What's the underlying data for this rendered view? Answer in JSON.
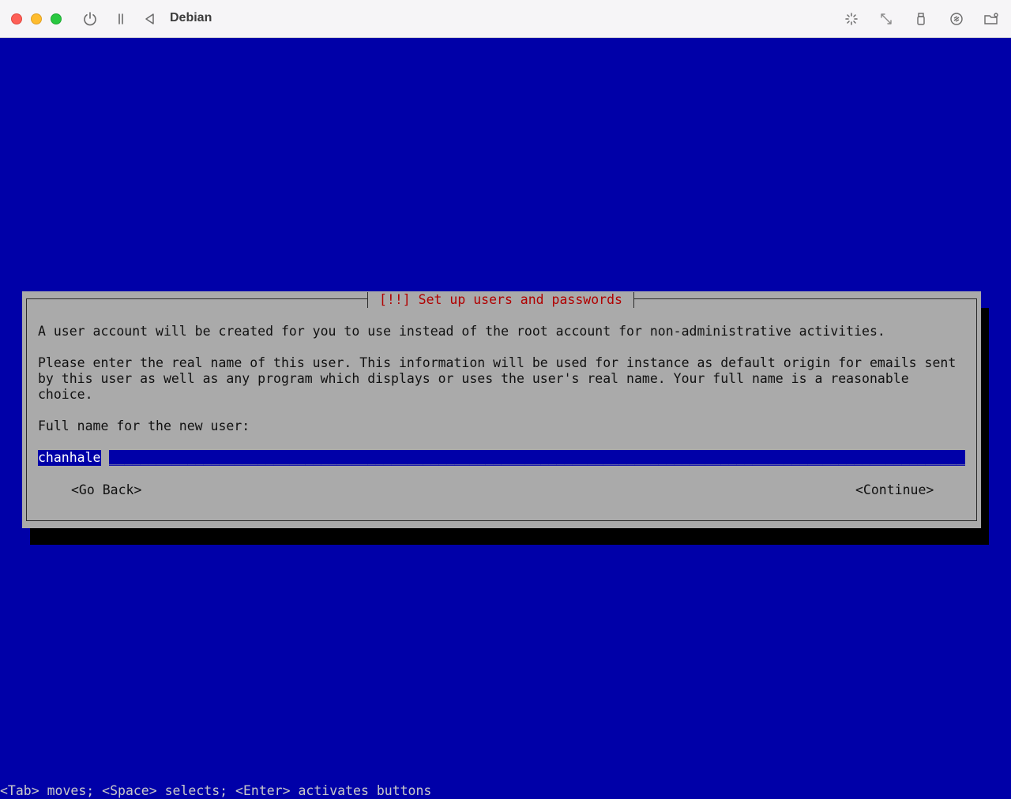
{
  "window": {
    "title": "Debian",
    "icons": [
      "power-icon",
      "pause-icon",
      "back-icon",
      "brightness-icon",
      "resize-icon",
      "usb-icon",
      "audio-icon",
      "shared-folder-icon"
    ]
  },
  "dialog": {
    "title": "[!!] Set up users and passwords",
    "intro": "A user account will be created for you to use instead of the root account for non-administrative activities.",
    "description_lines": [
      "Please enter the real name of this user. This information will be used for instance as default origin for emails sent",
      "by this user as well as any program which displays or uses the user's real name. Your full name is a reasonable",
      "choice."
    ],
    "prompt": "Full name for the new user:",
    "input_value": "chanhale",
    "go_back_label": "<Go Back>",
    "continue_label": "<Continue>"
  },
  "status_bar": {
    "help": "<Tab> moves; <Space> selects; <Enter> activates buttons"
  },
  "colors": {
    "background": "#0000a8",
    "dialog": "#aaaaaa",
    "title_text": "#b00000"
  }
}
